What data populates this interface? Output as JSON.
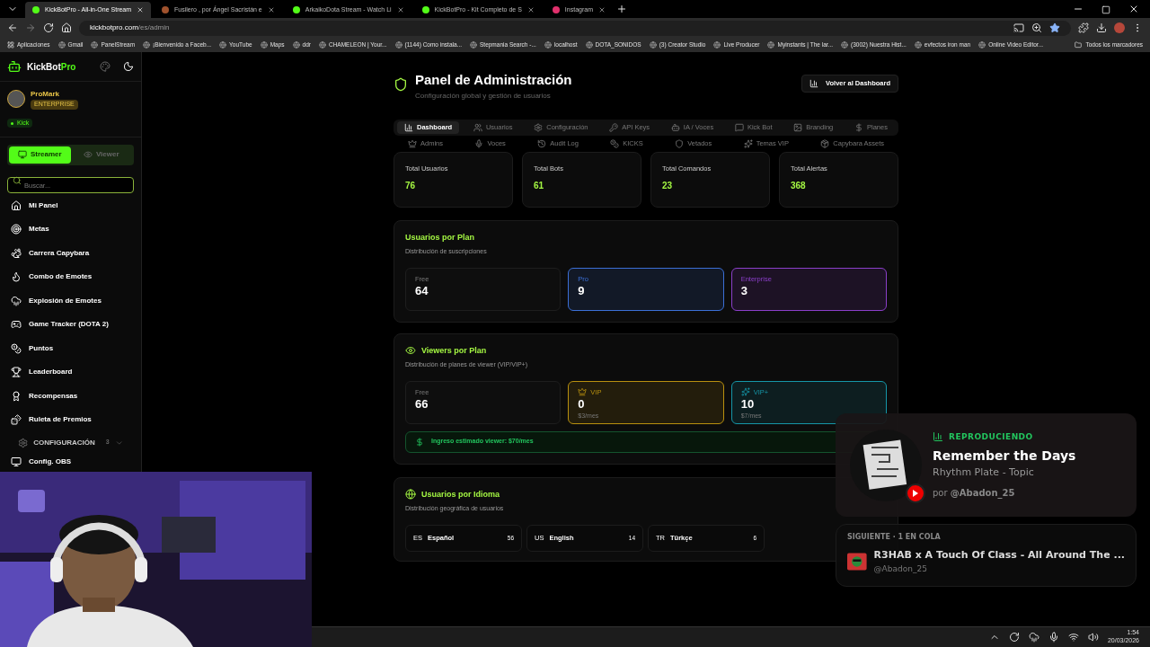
{
  "browser": {
    "tabs": [
      {
        "title": "KickBotPro - All-in-One Stream",
        "selected": true
      },
      {
        "title": "Fusilero , por Ángel Sacristán e",
        "selected": false
      },
      {
        "title": "ArkaikoDota Stream - Watch Li",
        "selected": false
      },
      {
        "title": "KickBotPro - Kit Completo de S",
        "selected": false
      },
      {
        "title": "Instagram",
        "selected": false
      }
    ],
    "url": {
      "host": "kickbotpro.com",
      "path": "/es/admin"
    },
    "bookmarks": [
      "Aplicaciones",
      "Gmail",
      "PanelStream",
      "¡Bienvenido a Faceb...",
      "YouTube",
      "Maps",
      "ddr",
      "CHAMELEON | Your...",
      "(1144) Como instala...",
      "Stepmania Search -...",
      "localhost",
      "DOTA_SONIDOS",
      "(3) Creator Studio",
      "Live Producer",
      "Myinstants | The lar...",
      "(3002) Nuestra Hist...",
      "evfectos iron man",
      "Online Video Editor..."
    ],
    "bookmarks_folder": "Todos los marcadores"
  },
  "sidebar": {
    "brand": [
      "KickBot",
      "Pro"
    ],
    "user": {
      "name": "ProMark",
      "plan": "ENTERPRISE",
      "platform": "Kick"
    },
    "modes": [
      {
        "label": "Streamer",
        "selected": true
      },
      {
        "label": "Viewer",
        "selected": false
      }
    ],
    "search": {
      "placeholder": "Buscar..."
    },
    "items": [
      "Mi Panel",
      "Metas",
      "Carrera Capybara",
      "Combo de Emotes",
      "Explosión de Emotes",
      "Game Tracker (DOTA 2)",
      "Puntos",
      "Leaderboard",
      "Recompensas",
      "Ruleta de Premios"
    ],
    "section": {
      "label": "CONFIGURACIÓN",
      "count": "3",
      "expanded": false
    },
    "section_items": [
      "Config. OBS"
    ]
  },
  "header": {
    "title": "Panel de Administración",
    "subtitle": "Configuración global y gestión de usuarios",
    "back_button": "Volver al Dashboard"
  },
  "tabs": [
    [
      {
        "label": "Dashboard",
        "selected": true
      },
      {
        "label": "Usuarios",
        "selected": false
      },
      {
        "label": "Configuración",
        "selected": false
      },
      {
        "label": "API Keys",
        "selected": false
      },
      {
        "label": "IA / Voces",
        "selected": false
      },
      {
        "label": "Kick Bot",
        "selected": false
      },
      {
        "label": "Branding",
        "selected": false
      },
      {
        "label": "Planes",
        "selected": false
      }
    ],
    [
      {
        "label": "Admins",
        "selected": false
      },
      {
        "label": "Voces",
        "selected": false
      },
      {
        "label": "Audit Log",
        "selected": false
      },
      {
        "label": "KICKS",
        "selected": false
      },
      {
        "label": "Vetados",
        "selected": false
      },
      {
        "label": "Temas VIP",
        "selected": false
      },
      {
        "label": "Capybara Assets",
        "selected": false
      }
    ]
  ],
  "stats": [
    {
      "label": "Total Usuarios",
      "value": "76"
    },
    {
      "label": "Total Bots",
      "value": "61"
    },
    {
      "label": "Total Comandos",
      "value": "23"
    },
    {
      "label": "Total Alertas",
      "value": "368"
    }
  ],
  "users_by_plan": {
    "title": "Usuarios por Plan",
    "subtitle": "Distribución de suscripciones",
    "plans": [
      {
        "label": "Free",
        "value": "64",
        "color": "#1e1e1e"
      },
      {
        "label": "Pro",
        "value": "9",
        "color": "#3b6fd6"
      },
      {
        "label": "Enterprise",
        "value": "3",
        "color": "#8b3fc9"
      }
    ]
  },
  "viewers_by_plan": {
    "title": "Viewers por Plan",
    "subtitle": "Distribución de planes de viewer (VIP/VIP+)",
    "plans": [
      {
        "label": "Free",
        "value": "66",
        "color": "#1e1e1e"
      },
      {
        "label": "VIP",
        "value": "0",
        "price": "$3/mes",
        "color": "#b8900f"
      },
      {
        "label": "VIP+",
        "value": "10",
        "price": "$7/mes",
        "color": "#1596a8"
      }
    ],
    "revenue": "Ingreso estimado viewer: $70/mes"
  },
  "languages": {
    "title": "Usuarios por Idioma",
    "subtitle": "Distribución geográfica de usuarios",
    "items": [
      {
        "code": "ES",
        "name": "Español",
        "count": "56"
      },
      {
        "code": "US",
        "name": "English",
        "count": "14"
      },
      {
        "code": "TR",
        "name": "Türkçe",
        "count": "6"
      }
    ]
  },
  "now_playing": {
    "status": "REPRODUCIENDO",
    "title": "Remember the Days",
    "artist": "Rhythm Plate - Topic",
    "by": "por **@Abadon_25**"
  },
  "queue": {
    "heading": "SIGUIENTE · 1 EN COLA",
    "title": "R3HAB x A Touch Of Class - All Around The ...",
    "user": "@Abadon_25"
  },
  "taskbar": {
    "time": "1:54",
    "date": "20/03/2026"
  }
}
